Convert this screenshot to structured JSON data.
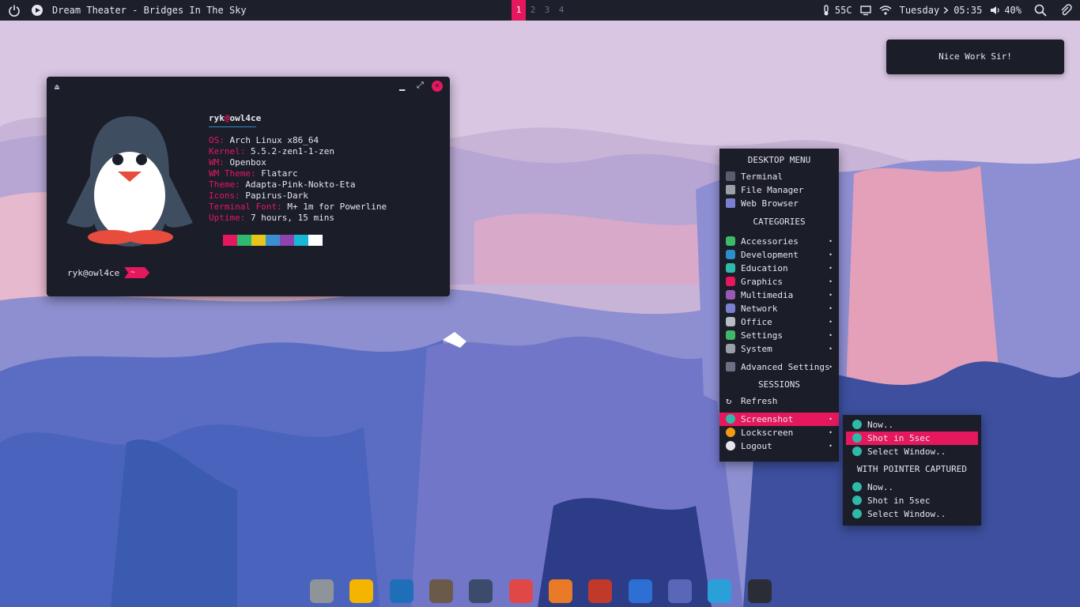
{
  "panel": {
    "now_playing": "Dream Theater - Bridges In The Sky",
    "workspaces": [
      "1",
      "2",
      "3",
      "4"
    ],
    "active_workspace": "1",
    "temperature": "55C",
    "day": "Tuesday",
    "time": "05:35",
    "volume": "40%",
    "icons": [
      "power-icon",
      "play-icon",
      "thermometer-icon",
      "monitor-icon",
      "wifi-icon",
      "chevron-right-icon",
      "volume-icon",
      "search-icon",
      "paperclip-icon"
    ]
  },
  "terminal": {
    "user_host": {
      "user": "ryk",
      "at": "@",
      "host": "owl4ce"
    },
    "info": [
      {
        "key": "OS:",
        "value": "Arch Linux x86_64"
      },
      {
        "key": "Kernel:",
        "value": "5.5.2-zen1-1-zen"
      },
      {
        "key": "WM:",
        "value": "Openbox"
      },
      {
        "key": "WM Theme:",
        "value": "Flatarc"
      },
      {
        "key": "Theme:",
        "value": "Adapta-Pink-Nokto-Eta"
      },
      {
        "key": "Icons:",
        "value": "Papirus-Dark"
      },
      {
        "key": "Terminal Font:",
        "value": "M+ 1m for Powerline"
      },
      {
        "key": "Uptime:",
        "value": "7 hours, 15 mins"
      }
    ],
    "swatch_colors": [
      "#e5185e",
      "#2eb872",
      "#e6c619",
      "#3b8fd0",
      "#8e44ad",
      "#1ab6d8",
      "#ffffff"
    ],
    "prompt": "ryk@owl4ce",
    "prompt_tag": "~"
  },
  "notification": {
    "text": "Nice Work Sir!"
  },
  "desktop_menu": {
    "title": "DESKTOP MENU",
    "apps": [
      {
        "label": "Terminal",
        "icon": "terminal-icon",
        "color": "#5a5d6e"
      },
      {
        "label": "File Manager",
        "icon": "file-manager-icon",
        "color": "#9aa0a8"
      },
      {
        "label": "Web Browser",
        "icon": "web-browser-icon",
        "color": "#7a7fd0"
      }
    ],
    "categories_title": "CATEGORIES",
    "categories": [
      {
        "label": "Accessories",
        "icon": "accessories-icon",
        "color": "#3fb86a"
      },
      {
        "label": "Development",
        "icon": "development-icon",
        "color": "#2c8fc7"
      },
      {
        "label": "Education",
        "icon": "education-icon",
        "color": "#2fb9a8"
      },
      {
        "label": "Graphics",
        "icon": "graphics-icon",
        "color": "#e5185e"
      },
      {
        "label": "Multimedia",
        "icon": "multimedia-icon",
        "color": "#9b59b6"
      },
      {
        "label": "Network",
        "icon": "network-icon",
        "color": "#7a7fd0"
      },
      {
        "label": "Office",
        "icon": "office-icon",
        "color": "#b8bcc6"
      },
      {
        "label": "Settings",
        "icon": "settings-icon",
        "color": "#3fb86a"
      },
      {
        "label": "System",
        "icon": "system-icon",
        "color": "#9aa0a8"
      }
    ],
    "advanced": {
      "label": "Advanced Settings",
      "icon": "advanced-settings-icon",
      "color": "#6c6f85"
    },
    "sessions_title": "SESSIONS",
    "refresh": "Refresh",
    "sessions": [
      {
        "label": "Screenshot",
        "icon": "screenshot-icon",
        "color": "#2fb9a8",
        "selected": true
      },
      {
        "label": "Lockscreen",
        "icon": "lock-icon",
        "color": "#f39c12",
        "selected": false
      },
      {
        "label": "Logout",
        "icon": "logout-icon",
        "color": "#e6e6ee",
        "selected": false
      }
    ],
    "arrow": "•"
  },
  "screenshot_menu": {
    "items": [
      {
        "label": "Now..",
        "selected": false
      },
      {
        "label": "Shot in 5sec",
        "selected": true
      },
      {
        "label": "Select Window..",
        "selected": false
      }
    ],
    "pointer_title": "WITH POINTER CAPTURED",
    "pointer_items": [
      {
        "label": "Now.."
      },
      {
        "label": "Shot in 5sec"
      },
      {
        "label": "Select Window.."
      }
    ]
  },
  "dock": {
    "apps": [
      {
        "name": "files-dock-icon",
        "color": "#8f949a"
      },
      {
        "name": "teapot-dock-icon",
        "color": "#f4b400"
      },
      {
        "name": "text-editor-dock-icon",
        "color": "#1e6fb8"
      },
      {
        "name": "gimp-dock-icon",
        "color": "#6a5a4a"
      },
      {
        "name": "kdenlive-dock-icon",
        "color": "#3a4b6b"
      },
      {
        "name": "screen-recorder-dock-icon",
        "color": "#e04848"
      },
      {
        "name": "media-player-dock-icon",
        "color": "#e87a28"
      },
      {
        "name": "filezilla-dock-icon",
        "color": "#c0392b"
      },
      {
        "name": "browser-dock-icon",
        "color": "#2d6fd2"
      },
      {
        "name": "safari-dock-icon",
        "color": "#5a67b8"
      },
      {
        "name": "telegram-dock-icon",
        "color": "#2a9fd8"
      },
      {
        "name": "terminal-dock-icon",
        "color": "#2b2d36"
      }
    ]
  }
}
